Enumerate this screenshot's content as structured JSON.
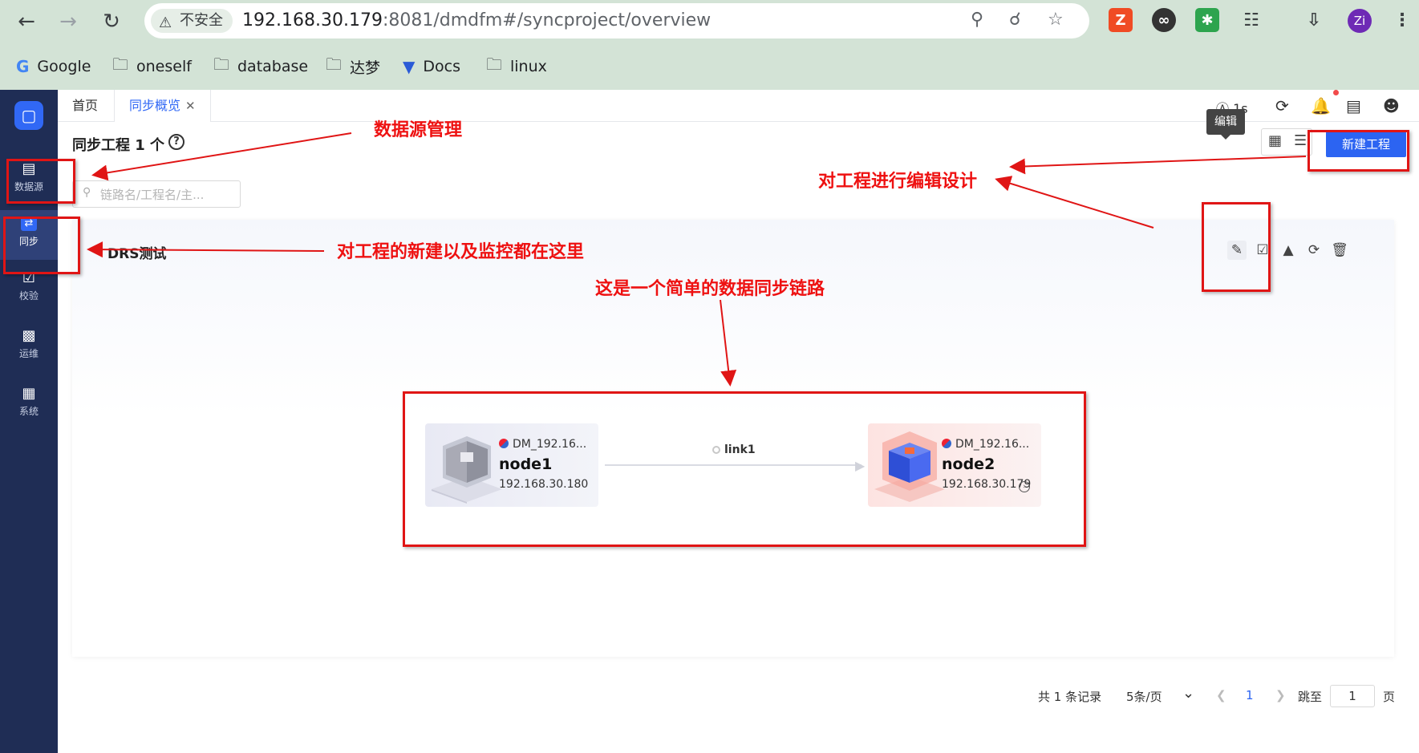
{
  "browser": {
    "security_label": "不安全",
    "url_host": "192.168.30.179",
    "url_rest": ":8081/dmdfm#/syncproject/overview",
    "profile_initial": "Zi",
    "bookmarks": [
      {
        "label": "Google",
        "icon": "google-icon"
      },
      {
        "label": "oneself",
        "icon": "folder-icon"
      },
      {
        "label": "database",
        "icon": "folder-icon"
      },
      {
        "label": "达梦",
        "icon": "folder-icon"
      },
      {
        "label": "Docs",
        "icon": "docs-icon"
      },
      {
        "label": "linux",
        "icon": "folder-icon"
      }
    ]
  },
  "sidebar": {
    "items": [
      {
        "label": "数据源",
        "icon": "database-icon"
      },
      {
        "label": "同步",
        "icon": "sync-icon",
        "active": true
      },
      {
        "label": "校验",
        "icon": "check-icon"
      },
      {
        "label": "运维",
        "icon": "terminal-icon"
      },
      {
        "label": "系统",
        "icon": "grid-icon"
      }
    ]
  },
  "tabs": [
    {
      "label": "首页"
    },
    {
      "label": "同步概览",
      "active": true
    }
  ],
  "topbar": {
    "refresh_interval": "1s"
  },
  "page": {
    "title": "同步工程 1 个",
    "new_project_label": "新建工程",
    "search_placeholder": "链路名/工程名/主..."
  },
  "project": {
    "name": "DRS测试",
    "tooltip": "编辑",
    "actions": [
      "edit-icon",
      "monitor-icon",
      "upload-icon",
      "refresh-icon",
      "delete-icon"
    ],
    "source": {
      "db": "DM_192.16...",
      "name": "node1",
      "ip": "192.168.30.180"
    },
    "link": {
      "name": "link1"
    },
    "target": {
      "db": "DM_192.16...",
      "name": "node2",
      "ip": "192.168.30.179"
    }
  },
  "pagination": {
    "total": "共 1 条记录",
    "page_size": "5条/页",
    "current": "1",
    "jump_label": "跳至",
    "jump_value": "1",
    "page_unit": "页"
  },
  "annotations": {
    "datasource": "数据源管理",
    "edit_design": "对工程进行编辑设计",
    "create_monitor": "对工程的新建以及监控都在这里",
    "simple_link": "这是一个简单的数据同步链路"
  },
  "colors": {
    "accent": "#2c64f2",
    "sidebar": "#1f2d55",
    "annotation": "#e01515"
  }
}
